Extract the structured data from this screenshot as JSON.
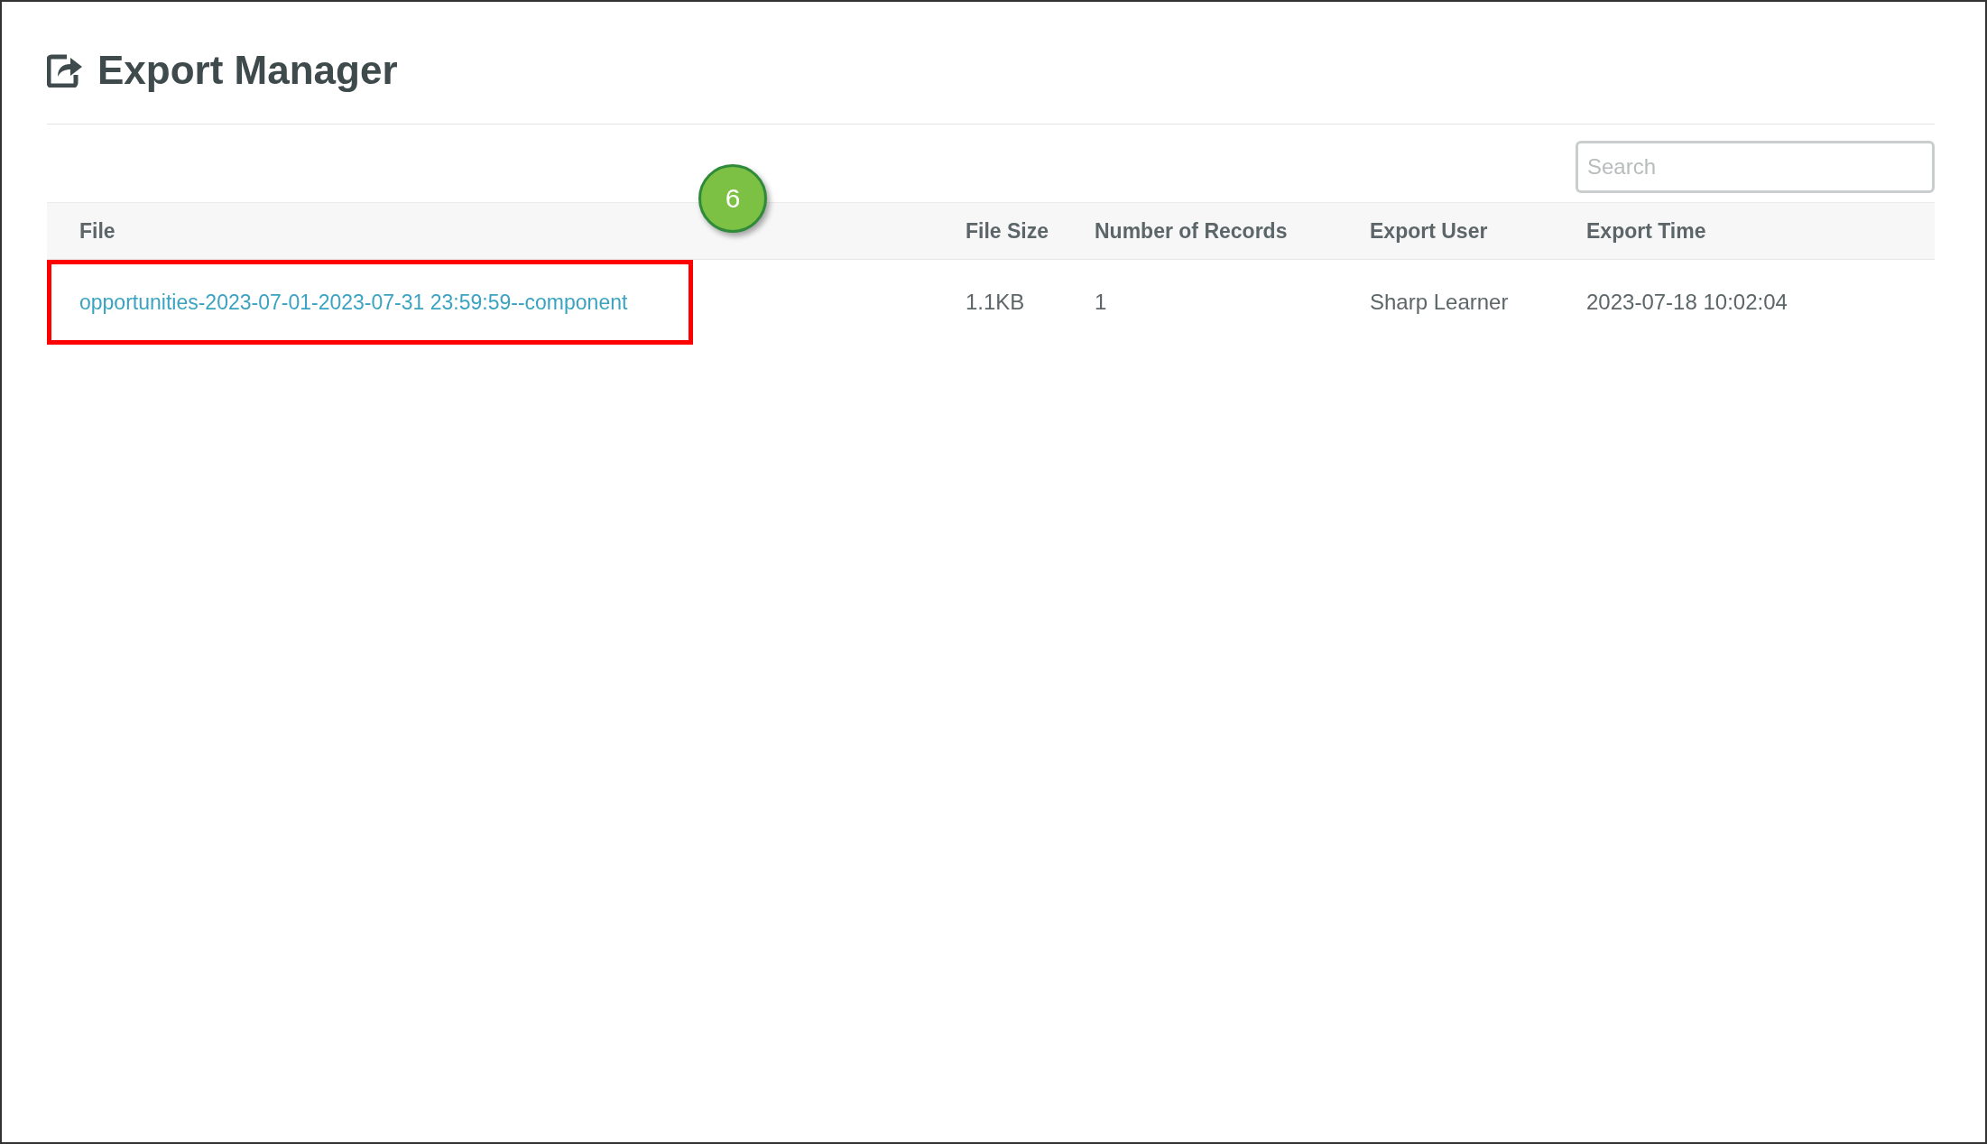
{
  "page": {
    "title": "Export Manager"
  },
  "search": {
    "placeholder": "Search"
  },
  "table": {
    "columns": [
      "File",
      "File Size",
      "Number of Records",
      "Export User",
      "Export Time"
    ],
    "rows": [
      {
        "file": "opportunities-2023-07-01-2023-07-31 23:59:59--component",
        "file_size": "1.1KB",
        "records": "1",
        "user": "Sharp Learner",
        "time": "2023-07-18 10:02:04",
        "highlighted": true
      }
    ]
  },
  "callout": {
    "number": "6"
  }
}
